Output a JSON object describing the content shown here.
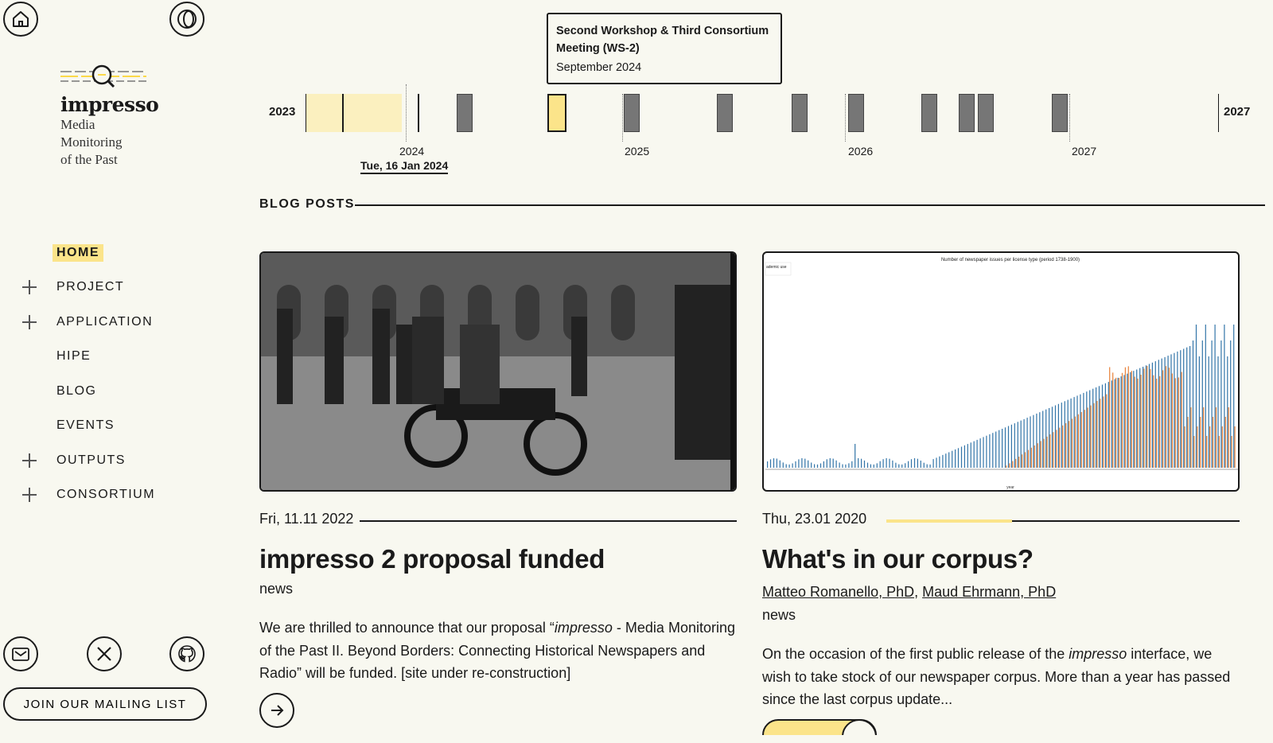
{
  "colors": {
    "background": "#f8f8f0",
    "accent": "#fbe48a",
    "event_gray": "#767676"
  },
  "logo": {
    "wordmark": "impresso",
    "tagline_lines": [
      "Media",
      "Monitoring",
      "of the Past"
    ]
  },
  "header_icons": [
    "home-icon",
    "theme-toggle-icon"
  ],
  "nav": {
    "items": [
      {
        "label": "HOME",
        "active": true,
        "expandable": false
      },
      {
        "label": "PROJECT",
        "expandable": true
      },
      {
        "label": "APPLICATION",
        "expandable": true
      },
      {
        "label": "HIPE",
        "expandable": false
      },
      {
        "label": "BLOG",
        "expandable": false
      },
      {
        "label": "EVENTS",
        "expandable": false
      },
      {
        "label": "OUTPUTS",
        "expandable": true
      },
      {
        "label": "CONSORTIUM",
        "expandable": true
      }
    ]
  },
  "social_icons": [
    "newsletter-icon",
    "x-twitter-icon",
    "github-icon"
  ],
  "mailing_button": "JOIN OUR MAILING LIST",
  "timeline": {
    "start_year": "2023",
    "end_year": "2027",
    "ticks": [
      "2024",
      "2025",
      "2026",
      "2027"
    ],
    "current_date": "Tue, 16 Jan 2024",
    "tooltip": {
      "title": "Second Workshop & Third Consortium Meeting (WS-2)",
      "date": "September 2024"
    }
  },
  "blog": {
    "section_title": "BLOG POSTS",
    "posts": [
      {
        "date": "Fri, 11.11 2022",
        "title": "impresso 2 proposal funded",
        "tag": "news",
        "desc_before": "We are thrilled to announce that our proposal “",
        "desc_em": "impresso",
        "desc_after": " - Media Monitoring of the Past II. Beyond Borders: Connecting Historical Newspapers and Radio” will be funded. [site under re-construction]",
        "image": "black-and-white photo of men on a motorcycle"
      },
      {
        "date": "Thu, 23.01 2020",
        "title": "What's in our corpus?",
        "authors": [
          "Matteo Romanello, PhD",
          "Maud Ehrmann, PhD"
        ],
        "tag": "news",
        "desc_before": "On the occasion of the first public release of the ",
        "desc_em": "impresso",
        "desc_after": " interface, we wish to take stock of our newspaper corpus. More than a year has passed since the last corpus update...",
        "chart_title": "Number of newspaper issues per license type (period 1738-1900)",
        "chart_legend": "ademic use",
        "chart_xlabel": "year"
      }
    ]
  }
}
